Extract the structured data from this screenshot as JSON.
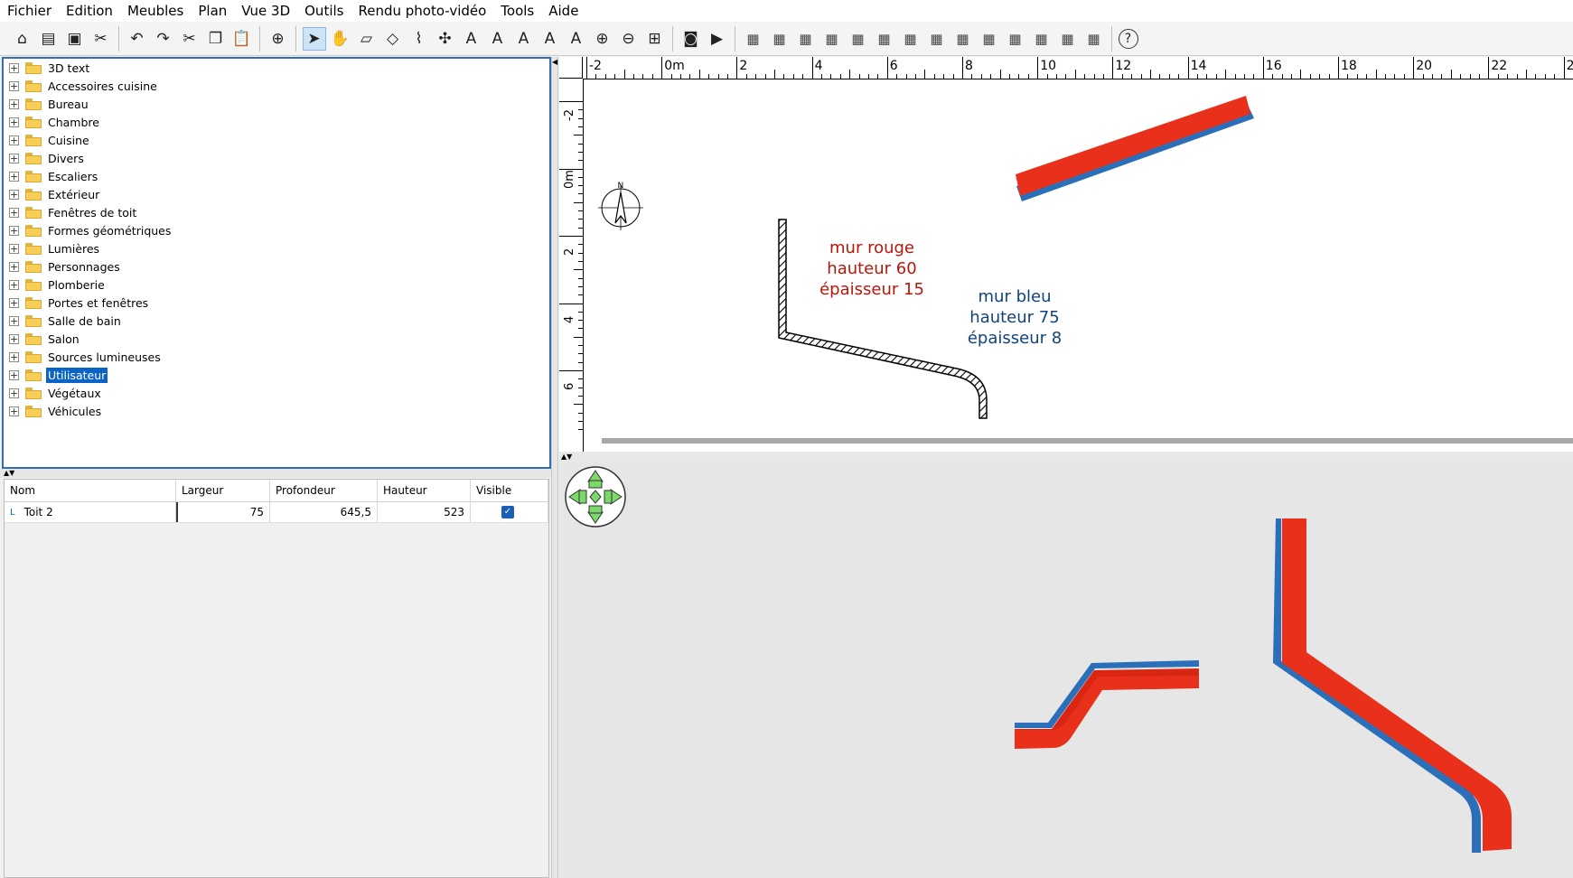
{
  "menu": [
    "Fichier",
    "Edition",
    "Meubles",
    "Plan",
    "Vue 3D",
    "Outils",
    "Rendu photo-vidéo",
    "Tools",
    "Aide"
  ],
  "toolbar": {
    "groups": [
      [
        "new-home-icon",
        "open-icon",
        "save-icon",
        "cut-tool-icon"
      ],
      [
        "undo-icon",
        "redo-icon",
        "cut-icon",
        "copy-icon",
        "paste-icon"
      ],
      [
        "add-furniture-icon"
      ],
      [
        "select-arrow-icon",
        "pan-hand-icon",
        "create-walls-icon",
        "create-rooms-icon",
        "create-polylines-icon",
        "create-dimensions-icon",
        "add-text-icon",
        "increase-text-icon",
        "decrease-text-icon",
        "bold-text-icon",
        "italic-text-icon",
        "zoom-in-icon",
        "zoom-out-icon",
        "zoom-fit-icon"
      ],
      [
        "photo-icon",
        "video-icon"
      ],
      [
        "plugin-1-icon",
        "plugin-2-icon",
        "plugin-3-icon",
        "plugin-4-icon",
        "plugin-5-icon",
        "plugin-6-icon",
        "plugin-7-icon",
        "plugin-8-icon",
        "plugin-9-icon",
        "plugin-10-icon",
        "plugin-11-icon",
        "plugin-12-icon",
        "plugin-13-icon",
        "plugin-14-icon"
      ],
      [
        "help-icon"
      ]
    ],
    "selected": "select-arrow-icon"
  },
  "catalog": {
    "items": [
      "3D text",
      "Accessoires cuisine",
      "Bureau",
      "Chambre",
      "Cuisine",
      "Divers",
      "Escaliers",
      "Extérieur",
      "Fenêtres de toit",
      "Formes géométriques",
      "Lumières",
      "Personnages",
      "Plomberie",
      "Portes et fenêtres",
      "Salle de bain",
      "Salon",
      "Sources lumineuses",
      "Utilisateur",
      "Végétaux",
      "Véhicules"
    ],
    "selected": "Utilisateur"
  },
  "furniture_table": {
    "headers": [
      "Nom",
      "Largeur",
      "Profondeur",
      "Hauteur",
      "Visible"
    ],
    "rows": [
      {
        "nom": "Toit 2",
        "largeur": "75",
        "profondeur": "645,5",
        "hauteur": "523",
        "visible": true
      }
    ]
  },
  "plan": {
    "ruler_top_labels": [
      "-2",
      "0m",
      "2",
      "4",
      "6",
      "8",
      "10",
      "12",
      "14",
      "16",
      "18",
      "20",
      "22",
      "2"
    ],
    "ruler_left_labels": [
      "-2",
      "0m",
      "2",
      "4",
      "6"
    ],
    "compass_letter": "N",
    "red_label": [
      "mur rouge",
      "hauteur 60",
      "épaisseur 15"
    ],
    "blue_label": [
      "mur bleu",
      "hauteur 75",
      "épaisseur 8"
    ],
    "colors": {
      "red_wall": "#e8301a",
      "blue_wall": "#2a6fb8",
      "red_text": "#b5170a",
      "blue_text": "#12427c"
    }
  }
}
